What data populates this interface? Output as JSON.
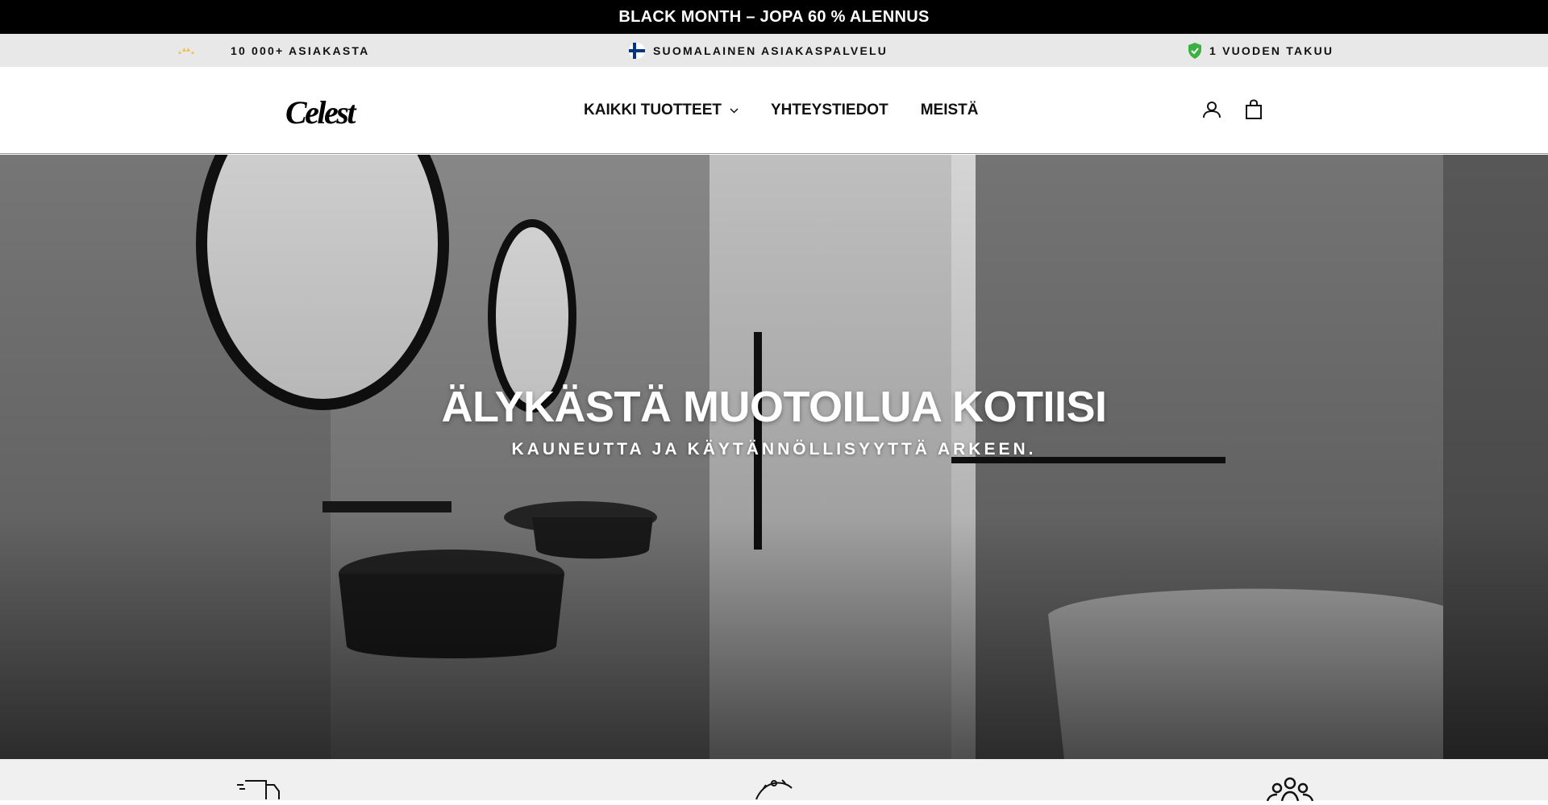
{
  "announcement": {
    "text": "BLACK MONTH – JOPA 60 % ALENNUS"
  },
  "trust_bar": {
    "items": [
      {
        "icon": "stars-icon",
        "label": "10 000+ ASIAKASTA"
      },
      {
        "icon": "finland-flag-icon",
        "label": "SUOMALAINEN ASIAKASPALVELU"
      },
      {
        "icon": "shield-check-icon",
        "label": "1 VUODEN TAKUU"
      }
    ]
  },
  "header": {
    "logo": "Celest",
    "nav": [
      {
        "label": "KAIKKI TUOTTEET",
        "has_dropdown": true
      },
      {
        "label": "YHTEYSTIEDOT"
      },
      {
        "label": "MEISTÄ"
      }
    ],
    "icons": [
      "account-icon",
      "cart-icon"
    ]
  },
  "hero": {
    "title": "ÄLYKÄSTÄ MUOTOILUA KOTIISI",
    "subtitle": "KAUNEUTTA JA KÄYTÄNNÖLLISYYTTÄ ARKEEN."
  },
  "features": {
    "icons": [
      "delivery-truck-icon",
      "sparkle-icon",
      "people-group-icon"
    ]
  },
  "colors": {
    "announcement_bg": "#000000",
    "trust_bar_bg": "#e8e8e8",
    "shield_green": "#3cb043",
    "flag_blue": "#003580"
  }
}
